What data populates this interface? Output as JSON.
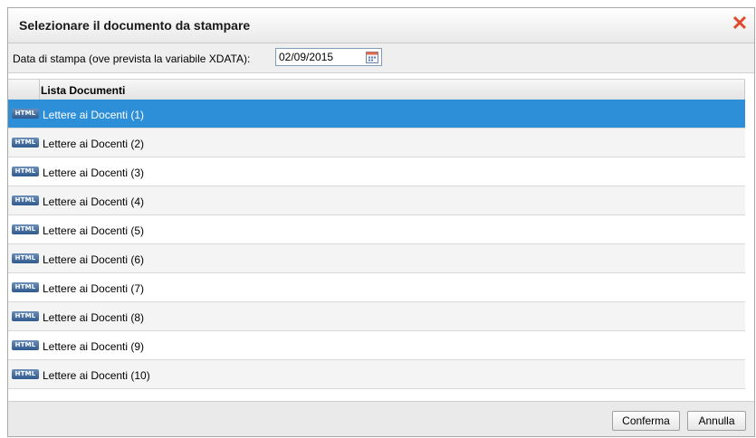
{
  "dialog": {
    "title": "Selezionare il documento da stampare",
    "close_icon": "close-x-icon"
  },
  "datebar": {
    "label": "Data di stampa (ove prevista la variabile XDATA):",
    "date_value": "02/09/2015",
    "calendar_icon": "calendar-icon"
  },
  "grid": {
    "header": "Lista Documenti",
    "icon_label": "HTML",
    "selected_index": 0,
    "rows": [
      "Lettere ai Docenti (1)",
      "Lettere ai Docenti (2)",
      "Lettere ai Docenti (3)",
      "Lettere ai Docenti (4)",
      "Lettere ai Docenti (5)",
      "Lettere ai Docenti (6)",
      "Lettere ai Docenti (7)",
      "Lettere ai Docenti (8)",
      "Lettere ai Docenti (9)",
      "Lettere ai Docenti (10)"
    ]
  },
  "footer": {
    "confirm_label": "Conferma",
    "cancel_label": "Annulla"
  },
  "colors": {
    "selected_row": "#2e8fd9",
    "close_icon": "#e04a2a"
  }
}
